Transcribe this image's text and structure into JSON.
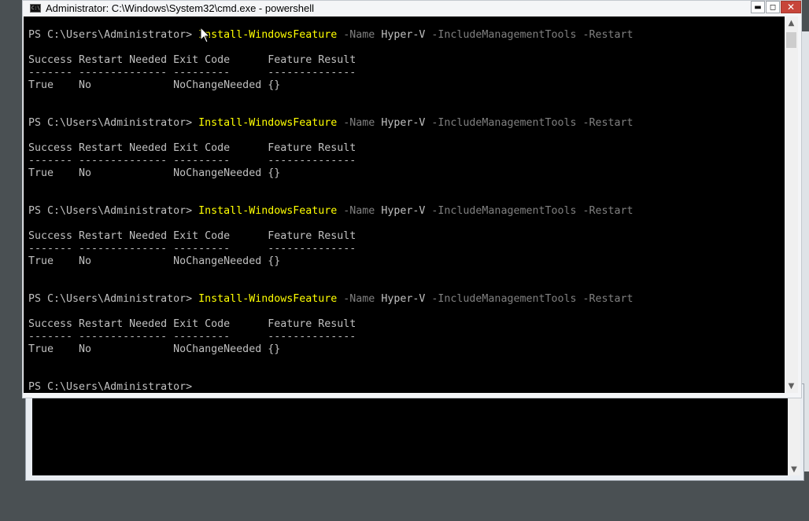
{
  "window": {
    "title": "Administrator: C:\\Windows\\System32\\cmd.exe - powershell",
    "icon": "console-icon",
    "minimize_glyph": "▬",
    "maximize_glyph": "◻",
    "close_glyph": "✕"
  },
  "console": {
    "background": "#000000",
    "text_color": "#C0C0C0",
    "command_color": "#FFFF00",
    "parameter_color": "#808080",
    "blocks": [
      {
        "prompt": "PS C:\\Users\\Administrator> ",
        "command": "Install-WindowsFeature",
        "params": [
          " -Name",
          " Hyper-V",
          " -IncludeManagementTools -Restart"
        ],
        "header": "Success Restart Needed Exit Code      Feature Result",
        "separator": "------- -------------- ---------      --------------",
        "row": "True    No             NoChangeNeeded {}"
      },
      {
        "prompt": "PS C:\\Users\\Administrator> ",
        "command": "Install-WindowsFeature",
        "params": [
          " -Name",
          " Hyper-V",
          " -IncludeManagementTools -Restart"
        ],
        "header": "Success Restart Needed Exit Code      Feature Result",
        "separator": "------- -------------- ---------      --------------",
        "row": "True    No             NoChangeNeeded {}"
      },
      {
        "prompt": "PS C:\\Users\\Administrator> ",
        "command": "Install-WindowsFeature",
        "params": [
          " -Name",
          " Hyper-V",
          " -IncludeManagementTools -Restart"
        ],
        "header": "Success Restart Needed Exit Code      Feature Result",
        "separator": "------- -------------- ---------      --------------",
        "row": "True    No             NoChangeNeeded {}"
      },
      {
        "prompt": "PS C:\\Users\\Administrator> ",
        "command": "Install-WindowsFeature",
        "params": [
          " -Name",
          " Hyper-V",
          " -IncludeManagementTools -Restart"
        ],
        "header": "Success Restart Needed Exit Code      Feature Result",
        "separator": "------- -------------- ---------      --------------",
        "row": "True    No             NoChangeNeeded {}"
      }
    ],
    "final_prompt": "PS C:\\Users\\Administrator>"
  },
  "scrollbar": {
    "up_glyph": "▲",
    "down_glyph": "▼"
  },
  "background_window": {
    "down_glyph": "▼"
  }
}
